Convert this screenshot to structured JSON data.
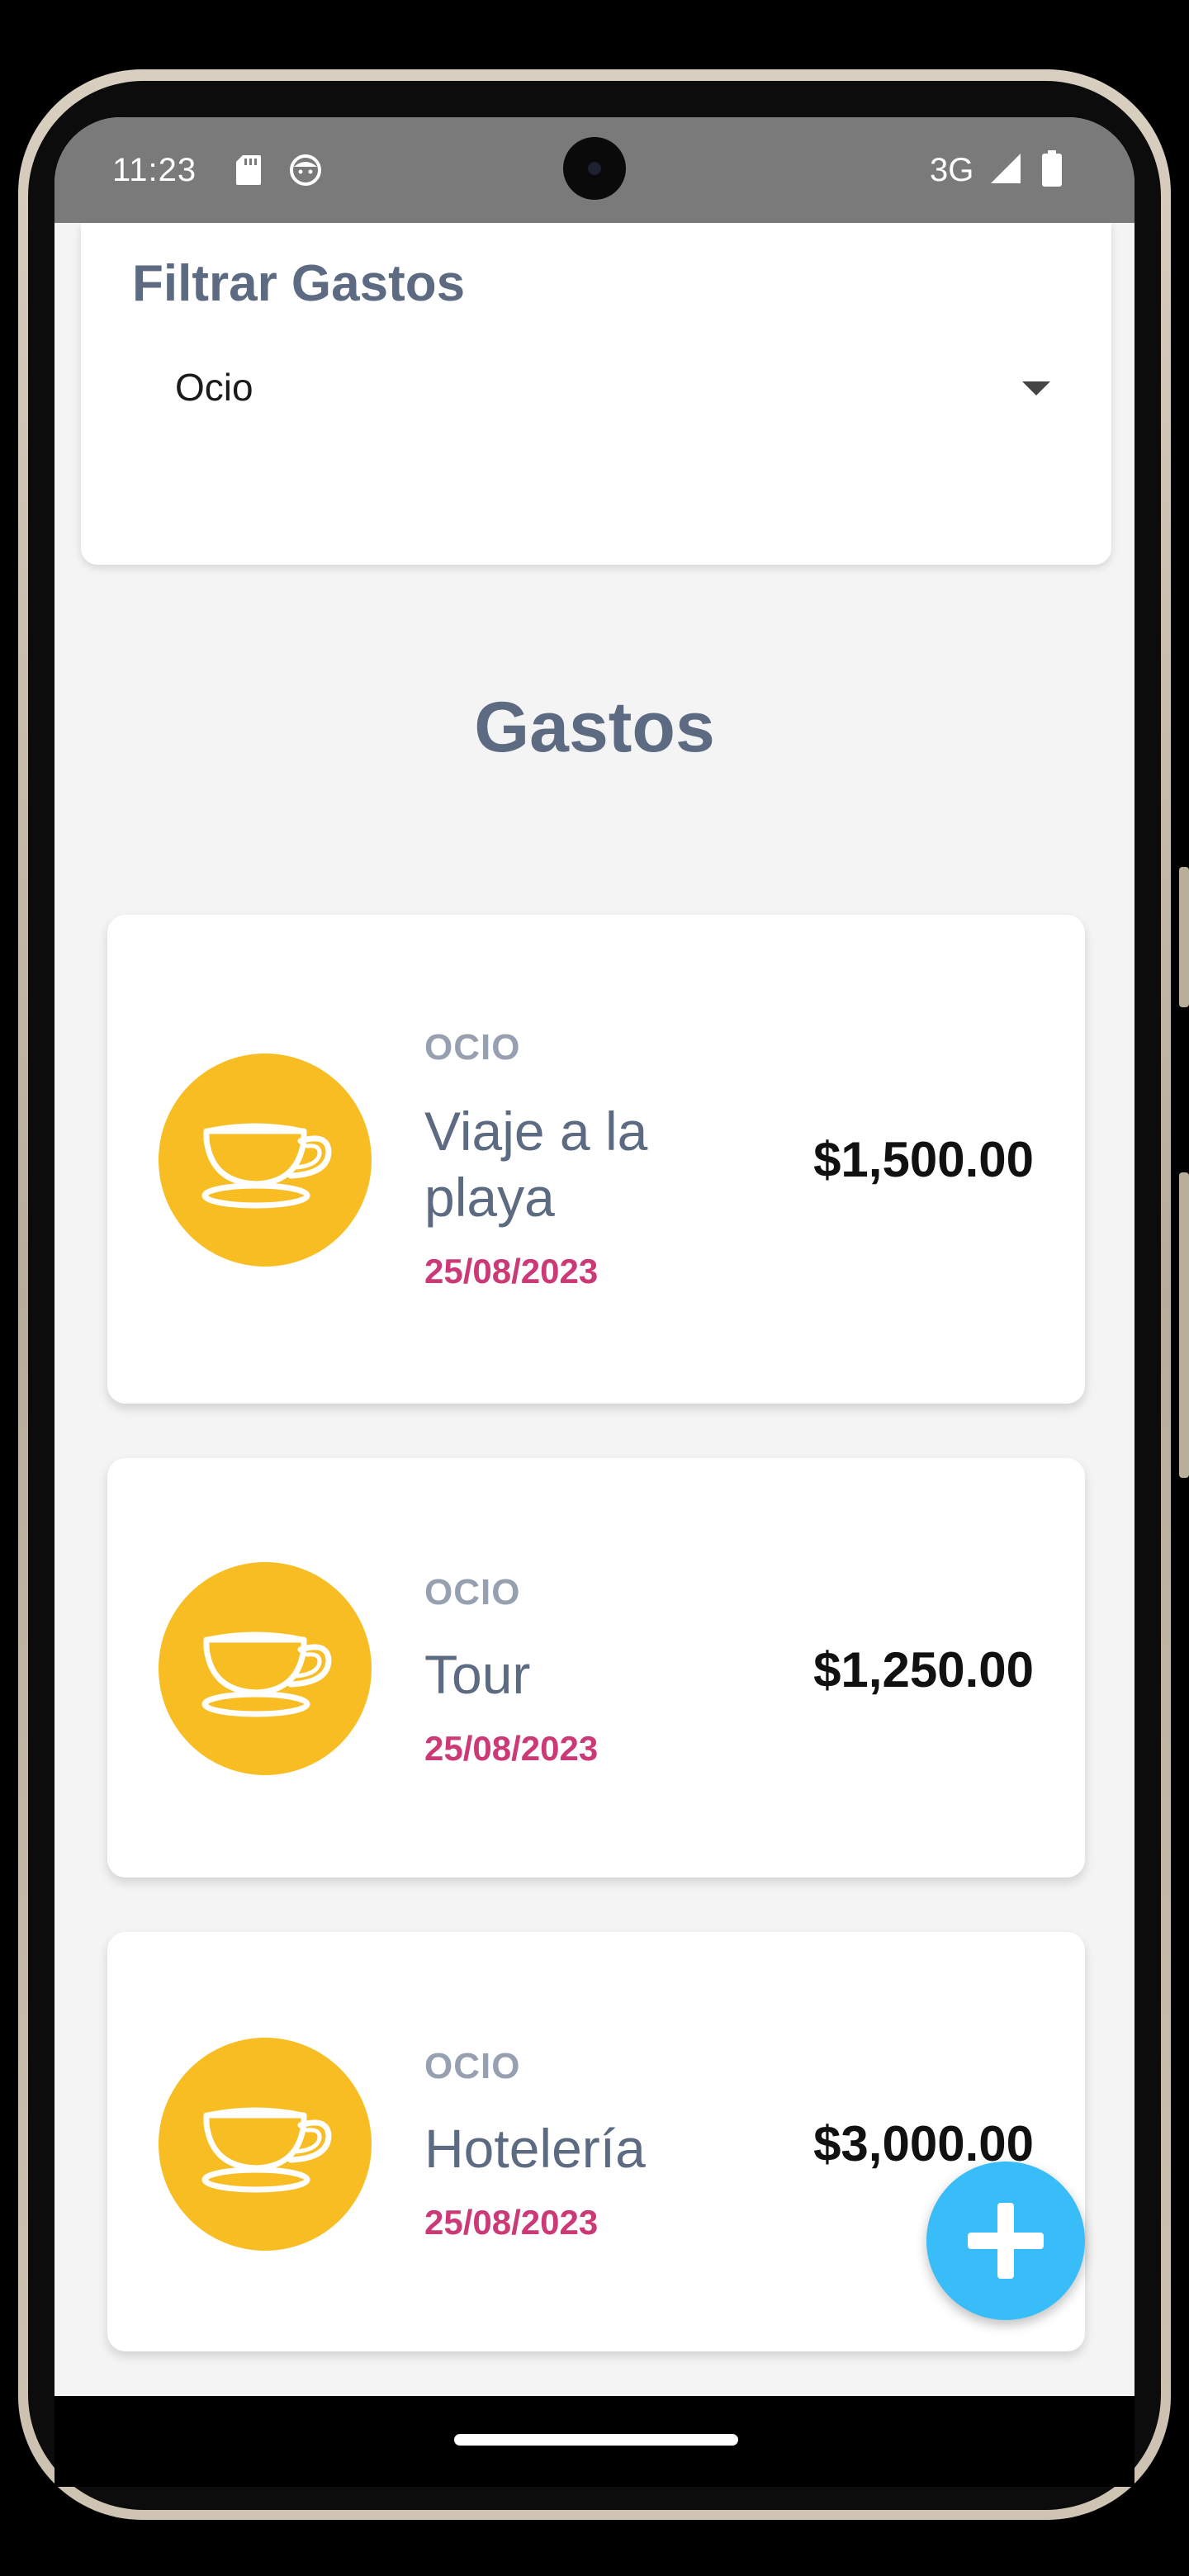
{
  "status_bar": {
    "time": "11:23",
    "network": "3G"
  },
  "filter": {
    "title": "Filtrar Gastos",
    "selected": "Ocio"
  },
  "section": {
    "title": "Gastos"
  },
  "expenses": [
    {
      "category": "OCIO",
      "name": "Viaje a la playa",
      "date": "25/08/2023",
      "amount": "$1,500.00",
      "icon": "teacup-icon"
    },
    {
      "category": "OCIO",
      "name": "Tour",
      "date": "25/08/2023",
      "amount": "$1,250.00",
      "icon": "teacup-icon"
    },
    {
      "category": "OCIO",
      "name": "Hotelería",
      "date": "25/08/2023",
      "amount": "$3,000.00",
      "icon": "teacup-icon"
    }
  ],
  "colors": {
    "icon_background": "#f8bd23",
    "date": "#cb3a76",
    "fab": "#38bdf8",
    "heading": "#5c6b82"
  },
  "fab": {
    "icon": "plus-icon"
  }
}
